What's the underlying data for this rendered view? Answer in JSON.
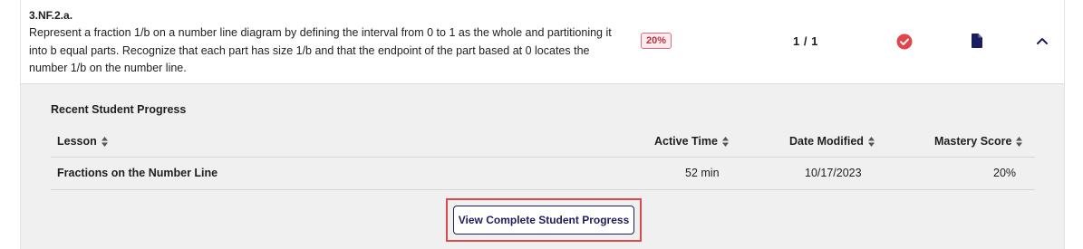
{
  "standard": {
    "code": "3.NF.2.a.",
    "description": "Represent a fraction 1/b on a number line diagram by defining the interval from 0 to 1 as the whole and partitioning it into b equal parts. Recognize that each part has size 1/b and that the endpoint of the part based at 0 locates the number 1/b on the number line.",
    "score_badge": "20%",
    "fraction": "1 / 1",
    "icons": {
      "status": "check-circle-icon",
      "document": "document-icon",
      "toggle": "chevron-up-icon"
    },
    "colors": {
      "badge_border": "#e06a78",
      "badge_bg": "#fdecef",
      "check": "#e0474c",
      "accent": "#1b1e5e"
    }
  },
  "progress": {
    "title": "Recent Student Progress",
    "columns": [
      "Lesson",
      "Active Time",
      "Date Modified",
      "Mastery Score"
    ],
    "rows": [
      {
        "lesson": "Fractions on the Number Line",
        "active_time": "52 min",
        "date_modified": "10/17/2023",
        "mastery_score": "20%"
      }
    ],
    "button_label": "View Complete Student Progress"
  }
}
